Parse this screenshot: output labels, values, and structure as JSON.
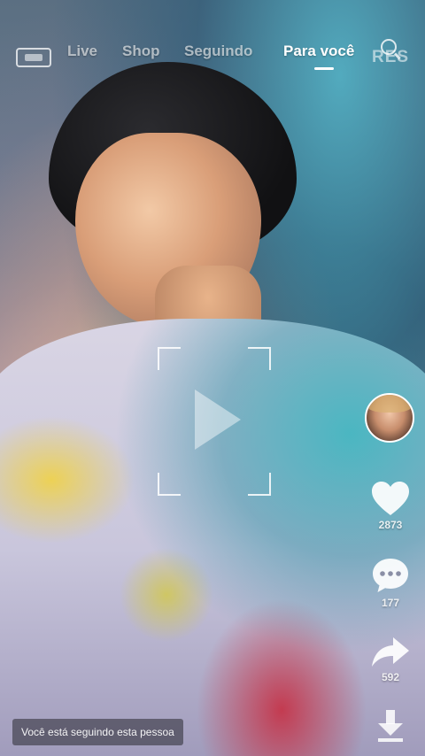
{
  "tabs": [
    {
      "label": "Live"
    },
    {
      "label": "Shop"
    },
    {
      "label": "Seguindo"
    },
    {
      "label": "Para você"
    }
  ],
  "active_tab": "Para você",
  "top_right_label": "RES",
  "actions": {
    "likes": "2873",
    "comments": "177",
    "shares": "592"
  },
  "toast": {
    "text": "Você está seguindo esta pessoa"
  },
  "icons": {
    "live": "live-icon",
    "search": "search-icon",
    "play": "play-icon",
    "like": "heart-icon",
    "comment": "comment-icon",
    "share": "share-icon",
    "download": "download-icon"
  }
}
